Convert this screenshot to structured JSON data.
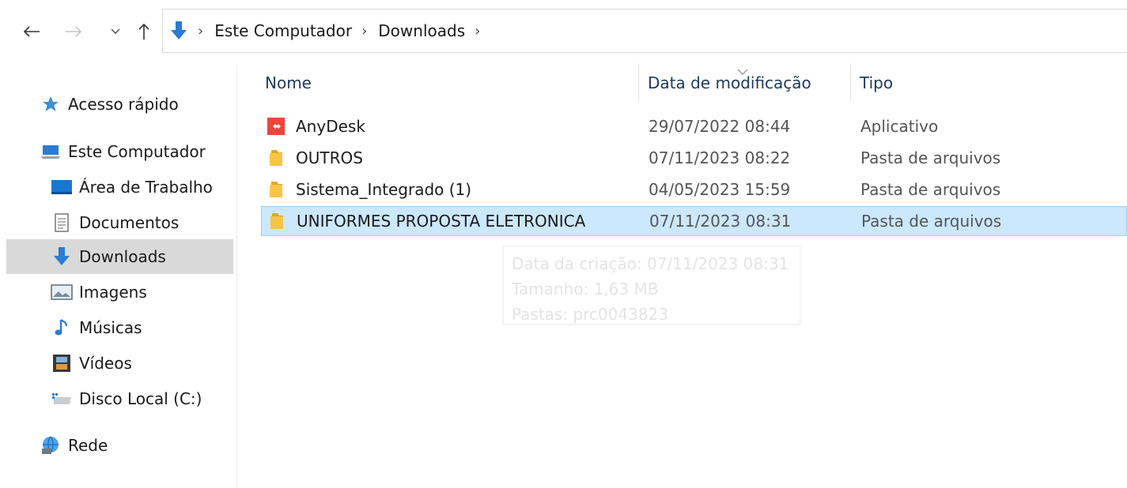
{
  "address_bar": {
    "crumbs": [
      "Este Computador",
      "Downloads"
    ]
  },
  "sidebar": {
    "items": [
      {
        "label": "Acesso rápido",
        "icon": "star-icon"
      },
      {
        "label": "Este Computador",
        "icon": "computer-icon"
      },
      {
        "label": "Área de Trabalho",
        "icon": "desktop-icon"
      },
      {
        "label": "Documentos",
        "icon": "document-icon"
      },
      {
        "label": "Downloads",
        "icon": "download-icon"
      },
      {
        "label": "Imagens",
        "icon": "image-icon"
      },
      {
        "label": "Músicas",
        "icon": "music-icon"
      },
      {
        "label": "Vídeos",
        "icon": "video-icon"
      },
      {
        "label": "Disco Local (C:)",
        "icon": "drive-icon"
      },
      {
        "label": "Rede",
        "icon": "network-icon"
      }
    ],
    "active": "Downloads"
  },
  "columns": {
    "name": "Nome",
    "date": "Data de modificação",
    "type": "Tipo"
  },
  "files": [
    {
      "name": "AnyDesk",
      "date": "29/07/2022 08:44",
      "type": "Aplicativo",
      "icon": "anydesk-icon"
    },
    {
      "name": "OUTROS",
      "date": "07/11/2023 08:22",
      "type": "Pasta de arquivos",
      "icon": "folder-icon"
    },
    {
      "name": "Sistema_Integrado (1)",
      "date": "04/05/2023 15:59",
      "type": "Pasta de arquivos",
      "icon": "folder-icon"
    },
    {
      "name": "UNIFORMES PROPOSTA ELETRONICA",
      "date": "07/11/2023 08:31",
      "type": "Pasta de arquivos",
      "icon": "folder-icon"
    }
  ],
  "selected_file": "UNIFORMES PROPOSTA ELETRONICA",
  "tooltip": {
    "line1": "Data da criação: 07/11/2023 08:31",
    "line2": "Tamanho: 1,63 MB",
    "line3": "Pastas: prc0043823"
  },
  "colors": {
    "accent": "#2b7cd3",
    "selection_bg": "#cce8ff",
    "selection_border": "#99d1ff",
    "sidebar_active": "#d9d9d9"
  }
}
